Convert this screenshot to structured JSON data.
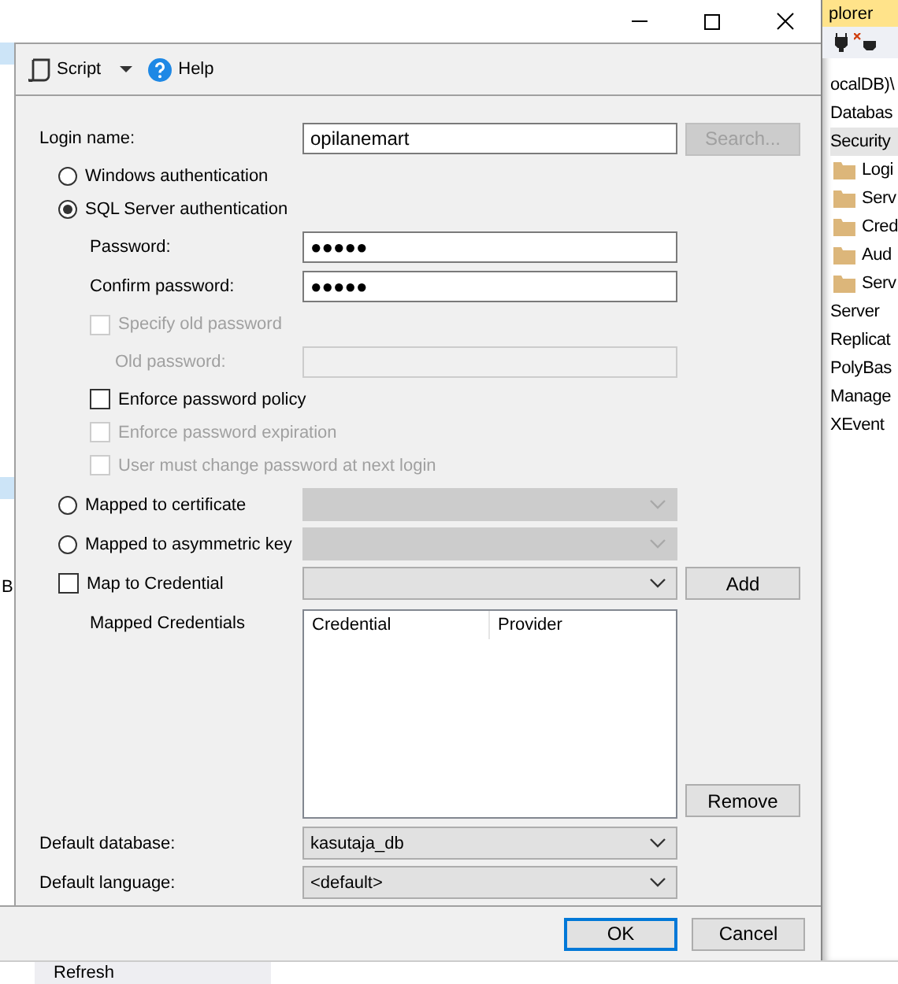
{
  "toolbar": {
    "items": [
      {
        "label": "Script",
        "kind": "script"
      },
      {
        "label": "Help",
        "kind": "help"
      }
    ]
  },
  "left_pane": {
    "text": "B"
  },
  "form": {
    "login_name": {
      "label": "Login name:",
      "value": "opilanemart"
    },
    "search_button": {
      "label": "Search...",
      "disabled": true
    },
    "auth_options": [
      {
        "label": "Windows authentication",
        "selected": false
      },
      {
        "label": "SQL Server authentication",
        "selected": true
      }
    ],
    "password": {
      "label": "Password:",
      "value": "●●●●●"
    },
    "confirm_password": {
      "label": "Confirm password:",
      "value": "●●●●●"
    },
    "specify_old_password": {
      "label": "Specify old password",
      "checked": false,
      "disabled": true
    },
    "old_password": {
      "label": "Old password:",
      "disabled": true
    },
    "policy_options": [
      {
        "label": "Enforce password policy",
        "checked": false,
        "disabled": false
      },
      {
        "label": "Enforce password expiration",
        "checked": false,
        "disabled": true
      },
      {
        "label": "User must change password at next login",
        "checked": false,
        "disabled": true
      }
    ],
    "mapping_options": [
      {
        "kind": "radio",
        "label": "Mapped to certificate",
        "selected": false,
        "dropdown_disabled": true
      },
      {
        "kind": "radio",
        "label": "Mapped to asymmetric key",
        "selected": false,
        "dropdown_disabled": true
      },
      {
        "kind": "checkbox",
        "label": "Map to Credential",
        "checked": false,
        "dropdown_disabled": false,
        "button": "Add"
      }
    ],
    "mapped_credentials": {
      "label": "Mapped Credentials",
      "columns": [
        "Credential",
        "Provider"
      ],
      "button": "Remove"
    },
    "default_database": {
      "label": "Default database:",
      "value": "kasutaja_db"
    },
    "default_language": {
      "label": "Default language:",
      "value": "<default>"
    }
  },
  "footer": {
    "buttons": [
      {
        "label": "OK",
        "default": true
      },
      {
        "label": "Cancel",
        "default": false
      }
    ]
  },
  "object_explorer": {
    "title": "plorer",
    "items": [
      {
        "label": "ocalDB)\\"
      },
      {
        "label": "Databas"
      },
      {
        "label": "Security",
        "selected": true,
        "children": [
          {
            "label": "Logi"
          },
          {
            "label": "Serv"
          },
          {
            "label": "Cred"
          },
          {
            "label": "Aud"
          },
          {
            "label": "Serv"
          }
        ]
      },
      {
        "label": "Server",
        "selected": false
      },
      {
        "label": "Replicat",
        "selected": false
      },
      {
        "label": "PolyBas",
        "selected": false
      },
      {
        "label": "Manage",
        "selected": false
      },
      {
        "label": "XEvent",
        "selected": false
      }
    ]
  },
  "background_button": {
    "label": "Refresh"
  }
}
